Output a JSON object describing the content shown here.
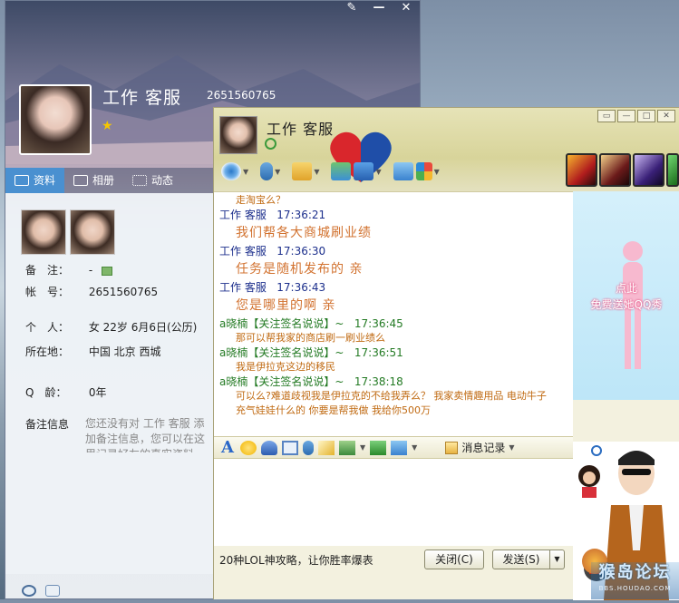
{
  "profile": {
    "name": "工作 客服",
    "qq": "2651560765",
    "tabs": [
      {
        "label": "资料",
        "icon": "profile-card-icon"
      },
      {
        "label": "相册",
        "icon": "album-icon"
      },
      {
        "label": "动态",
        "icon": "feed-icon"
      }
    ],
    "fields": {
      "remark_label": "备　注：",
      "remark_value": "-",
      "account_label": "帐　号：",
      "account_value": "2651560765",
      "personal_label": "个　人：",
      "personal_value": "女  22岁   6月6日(公历)",
      "location_label": "所在地：",
      "location_value": "中国 北京 西城",
      "qage_label": "Q　龄：",
      "qage_value": "0年",
      "note_label": "备注信息",
      "note_value": "您还没有对 工作 客服 添加备注信息，您可以在这里记录好友的真实资料、联系方式"
    }
  },
  "chat": {
    "title": "工作 客服",
    "messages": [
      {
        "kind": "cont",
        "text": "走淘宝么？"
      },
      {
        "kind": "head",
        "who": "sender",
        "sender": "工作 客服",
        "time": "17:36:21"
      },
      {
        "kind": "big",
        "text": "我们帮各大商城刷业绩"
      },
      {
        "kind": "head",
        "who": "sender",
        "sender": "工作 客服",
        "time": "17:36:30"
      },
      {
        "kind": "big",
        "text": "任务是随机发布的 亲"
      },
      {
        "kind": "head",
        "who": "sender",
        "sender": "工作 客服",
        "time": "17:36:43"
      },
      {
        "kind": "big",
        "text": "您是哪里的啊 亲"
      },
      {
        "kind": "head",
        "who": "self",
        "sender": "a晓楠【关注签名说说】~",
        "time": "17:36:45"
      },
      {
        "kind": "small",
        "text": "那可以帮我家的商店刷一刷业绩么"
      },
      {
        "kind": "head",
        "who": "self",
        "sender": "a晓楠【关注签名说说】~",
        "time": "17:36:51"
      },
      {
        "kind": "small",
        "text": "我是伊拉克这边的移民"
      },
      {
        "kind": "head",
        "who": "self",
        "sender": "a晓楠【关注签名说说】~",
        "time": "17:38:18"
      },
      {
        "kind": "small",
        "text": "可以么?难道歧视我是伊拉克的不给我弄么？ 我家卖情趣用品 电动牛子 充气娃娃什么的   你要是帮我做 我给你500万"
      }
    ],
    "show_link_1": "点此",
    "show_link_2": "免费送她QQ秀",
    "history_label": "消息记录",
    "ad_text": "20种LOL神攻略，让你胜率爆表",
    "close_label": "关闭(C)",
    "send_label": "发送(S)"
  },
  "watermark": {
    "main": "猴岛论坛",
    "sub": "BBS.HOUDAO.COM"
  },
  "colors": {
    "sender": "#1c2f8c",
    "self": "#237a23",
    "message_orange": "#d2722f",
    "tab_active": "#4a90d0"
  }
}
